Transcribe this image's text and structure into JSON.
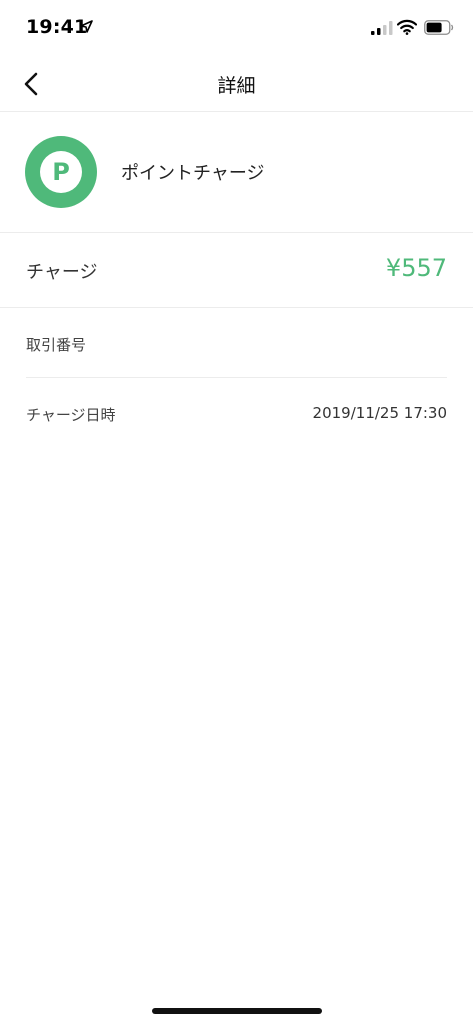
{
  "status_bar": {
    "time": "19:41",
    "icons": [
      "location-arrow-icon",
      "cellular-signal-icon",
      "wifi-icon",
      "battery-icon"
    ]
  },
  "nav": {
    "back_icon": "chevron-left-icon",
    "title": "詳細"
  },
  "header": {
    "icon_letter": "P",
    "icon_color": "#4fb97a",
    "title": "ポイントチャージ"
  },
  "amount": {
    "label": "チャージ",
    "value": "¥557",
    "value_color": "#4fb97a"
  },
  "details": [
    {
      "label": "取引番号",
      "value": ""
    },
    {
      "label": "チャージ日時",
      "value": "2019/11/25 17:30"
    }
  ]
}
